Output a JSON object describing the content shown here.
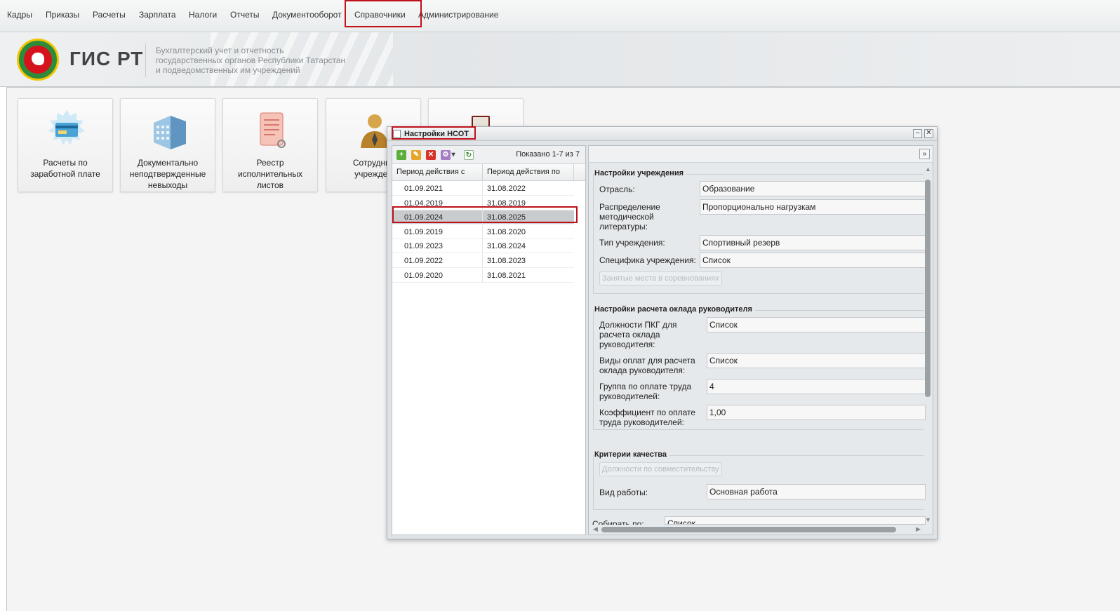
{
  "menu": {
    "items": [
      "Кадры",
      "Приказы",
      "Расчеты",
      "Зарплата",
      "Налоги",
      "Отчеты",
      "Документооборот",
      "Справочники",
      "Администрирование"
    ]
  },
  "header": {
    "brand": "ГИС РТ",
    "desc": [
      "Бухгалтерский учет и отчетность",
      "государственных органов Республики Татарстан",
      "и подведомственных им учреждений"
    ]
  },
  "tiles": [
    {
      "label": "Расчеты по\nзаработной плате",
      "icon": "payroll-card-icon"
    },
    {
      "label": "Документально\nнеподтвержденные\nневыходы",
      "icon": "office-building-icon"
    },
    {
      "label": "Реестр\nисполнительных\nлистов",
      "icon": "scroll-document-icon"
    },
    {
      "label": "Сотрудник\nучрежден",
      "icon": "employee-person-icon"
    },
    {
      "label": "",
      "icon": "book-icon"
    }
  ],
  "dialog": {
    "title": "Настройки НСОТ",
    "shown": "Показано 1-7 из 7",
    "columns": [
      "Период действия с",
      "Период действия по"
    ],
    "rows": [
      [
        "01.09.2021",
        "31.08.2022"
      ],
      [
        "01.04.2019",
        "31.08.2019"
      ],
      [
        "01.09.2024",
        "31.08.2025"
      ],
      [
        "01.09.2019",
        "31.08.2020"
      ],
      [
        "01.09.2023",
        "31.08.2024"
      ],
      [
        "01.09.2022",
        "31.08.2023"
      ],
      [
        "01.09.2020",
        "31.08.2021"
      ]
    ],
    "selected_row": 2,
    "sections": {
      "institution": {
        "title": "Настройки учреждения",
        "industry_label": "Отрасль:",
        "industry_value": "Образование",
        "literature_label": "Распределение\nметодической\nлитературы:",
        "literature_value": "Пропорционально нагрузкам",
        "type_label": "Тип учреждения:",
        "type_value": "Спортивный резерв",
        "specific_label": "Специфика учреждения:",
        "specific_value": "Список",
        "places_button": "Занятые места в соревнованиях"
      },
      "head_salary": {
        "title": "Настройки расчета оклада руководителя",
        "pkg_label": "Должности ПКГ для\nрасчета оклада\nруководителя:",
        "pkg_value": "Список",
        "pay_label": "Виды оплат для расчета\nоклада руководителя:",
        "pay_value": "Список",
        "group_label": "Группа по оплате труда\nруководителей:",
        "group_value": "4",
        "coef_label": "Коэффициент по оплате\nтруда руководителей:",
        "coef_value": "1,00"
      },
      "quality": {
        "title": "Критерии качества",
        "combo_button": "Должности по совместительству",
        "work_label": "Вид работы:",
        "work_value": "Основная работа",
        "collect_label": "Собирать по:",
        "collect_value": "Список"
      }
    }
  },
  "colors": {
    "highlight": "#c0101a",
    "selected_row": "#c9ccce"
  }
}
